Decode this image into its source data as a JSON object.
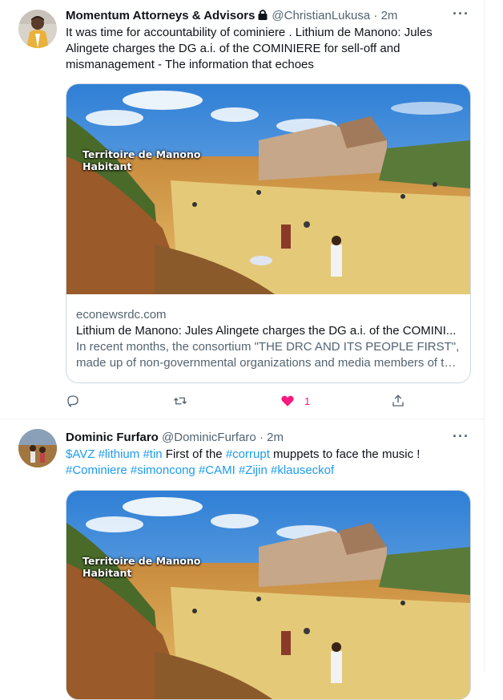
{
  "tweets": [
    {
      "name": "Momentum Attorneys & Advisors",
      "handle": "@ChristianLukusa",
      "time": "2m",
      "more": "···",
      "body_lines": [
        "It was time for accountability of cominiere . Lithium de Manono: Jules",
        "Alingete charges the DG a.i. of the COMINIERE for sell-off and",
        "mismanagement - The information that echoes"
      ],
      "card": {
        "image_overlay": [
          "Territoire de Manono",
          "Habitant"
        ],
        "domain": "econewsrdc.com",
        "title": "Lithium de Manono: Jules Alingete charges the DG a.i. of the COMINI...",
        "description_lines": [
          "In recent months, the consortium \"THE DRC AND ITS PEOPLE FIRST\",",
          "made up of non-governmental organizations and media members of th..."
        ]
      },
      "actions": {
        "reply_icon": "reply-icon",
        "retweet_icon": "retweet-icon",
        "like_icon": "heart-filled-icon",
        "like_count": "1",
        "share_icon": "share-icon"
      }
    },
    {
      "name": "Dominic Furfaro",
      "handle": "@DominicFurfaro",
      "time": "2m",
      "more": "···",
      "body": {
        "segments_line1": [
          {
            "text": "$AVZ",
            "tag": true
          },
          {
            "text": " ",
            "tag": false
          },
          {
            "text": "#lithium",
            "tag": true
          },
          {
            "text": " ",
            "tag": false
          },
          {
            "text": "#tin",
            "tag": true
          },
          {
            "text": " First of the ",
            "tag": false
          },
          {
            "text": "#corrupt",
            "tag": true
          },
          {
            "text": " muppets to face the music !",
            "tag": false
          }
        ],
        "segments_line2": [
          {
            "text": "#Cominiere",
            "tag": true
          },
          {
            "text": " ",
            "tag": false
          },
          {
            "text": "#simoncong",
            "tag": true
          },
          {
            "text": " ",
            "tag": false
          },
          {
            "text": "#CAMI",
            "tag": true
          },
          {
            "text": " ",
            "tag": false
          },
          {
            "text": "#Zijin",
            "tag": true
          },
          {
            "text": " ",
            "tag": false
          },
          {
            "text": "#klauseckof",
            "tag": true
          }
        ]
      },
      "card": {
        "image_overlay": [
          "Territoire de Manono",
          "Habitant"
        ]
      }
    }
  ],
  "colors": {
    "link": "#1d9bf0",
    "like": "#f91880",
    "secondary_text": "#536471",
    "border": "#cfd9de"
  }
}
